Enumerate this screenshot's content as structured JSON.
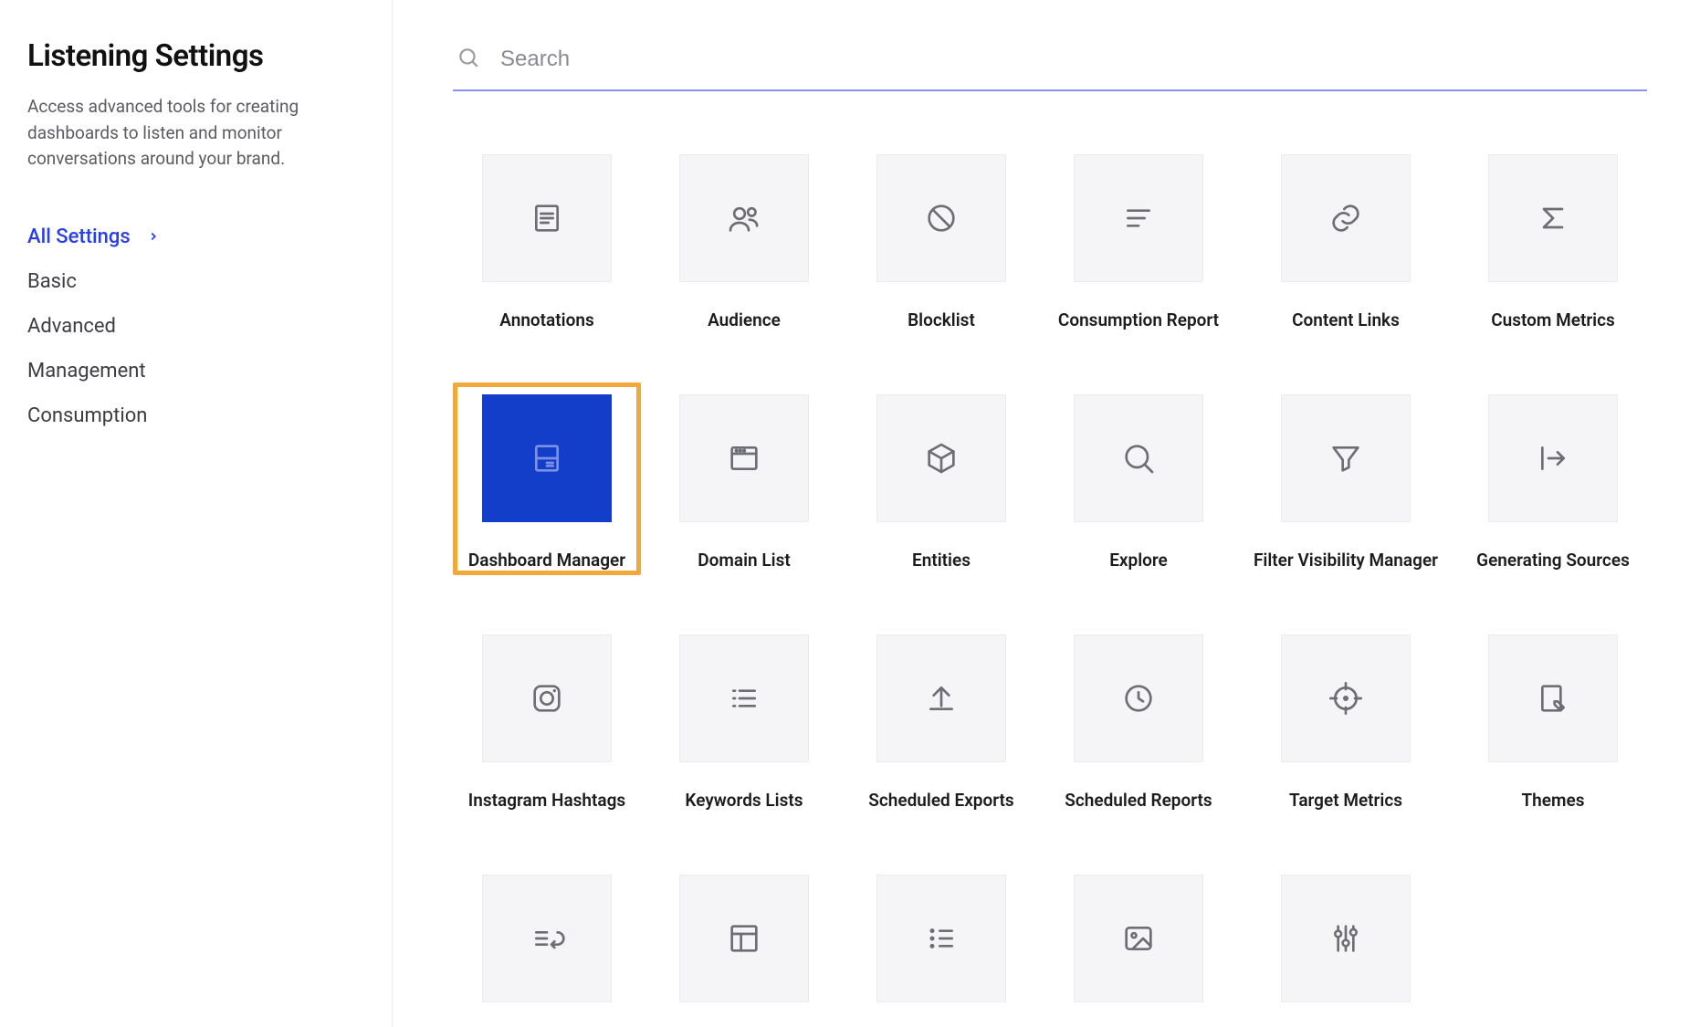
{
  "sidebar": {
    "title": "Listening Settings",
    "desc": "Access advanced tools for creating dashboards to listen and monitor conversations around your brand.",
    "nav": [
      {
        "label": "All Settings",
        "active": true
      },
      {
        "label": "Basic"
      },
      {
        "label": "Advanced"
      },
      {
        "label": "Management"
      },
      {
        "label": "Consumption"
      }
    ]
  },
  "search": {
    "placeholder": "Search"
  },
  "tiles": [
    {
      "id": "annotations",
      "label": "Annotations",
      "icon": "doc-lines"
    },
    {
      "id": "audience",
      "label": "Audience",
      "icon": "users"
    },
    {
      "id": "blocklist",
      "label": "Blocklist",
      "icon": "block"
    },
    {
      "id": "consumption-report",
      "label": "Consumption Report",
      "icon": "lines-stagger"
    },
    {
      "id": "content-links",
      "label": "Content Links",
      "icon": "link"
    },
    {
      "id": "custom-metrics",
      "label": "Custom Metrics",
      "icon": "sigma"
    },
    {
      "id": "dashboard-manager",
      "label": "Dashboard Manager",
      "icon": "dash",
      "highlight": true
    },
    {
      "id": "domain-list",
      "label": "Domain List",
      "icon": "window"
    },
    {
      "id": "entities",
      "label": "Entities",
      "icon": "cube"
    },
    {
      "id": "explore",
      "label": "Explore",
      "icon": "magnifier"
    },
    {
      "id": "filter-visibility",
      "label": "Filter Visibility Manager",
      "icon": "funnel"
    },
    {
      "id": "generating-sources",
      "label": "Generating Sources",
      "icon": "export-right"
    },
    {
      "id": "instagram-hashtags",
      "label": "Instagram Hashtags",
      "icon": "instagram"
    },
    {
      "id": "keywords-lists",
      "label": "Keywords Lists",
      "icon": "list-dots"
    },
    {
      "id": "scheduled-exports",
      "label": "Scheduled Exports",
      "icon": "upload"
    },
    {
      "id": "scheduled-reports",
      "label": "Scheduled Reports",
      "icon": "clock"
    },
    {
      "id": "target-metrics",
      "label": "Target Metrics",
      "icon": "crosshair"
    },
    {
      "id": "themes",
      "label": "Themes",
      "icon": "page-pen"
    },
    {
      "id": "undo",
      "label": "",
      "icon": "undo-list"
    },
    {
      "id": "layout",
      "label": "",
      "icon": "layout"
    },
    {
      "id": "bullet-list",
      "label": "",
      "icon": "bullets"
    },
    {
      "id": "image",
      "label": "",
      "icon": "image"
    },
    {
      "id": "sliders",
      "label": "",
      "icon": "sliders"
    }
  ]
}
